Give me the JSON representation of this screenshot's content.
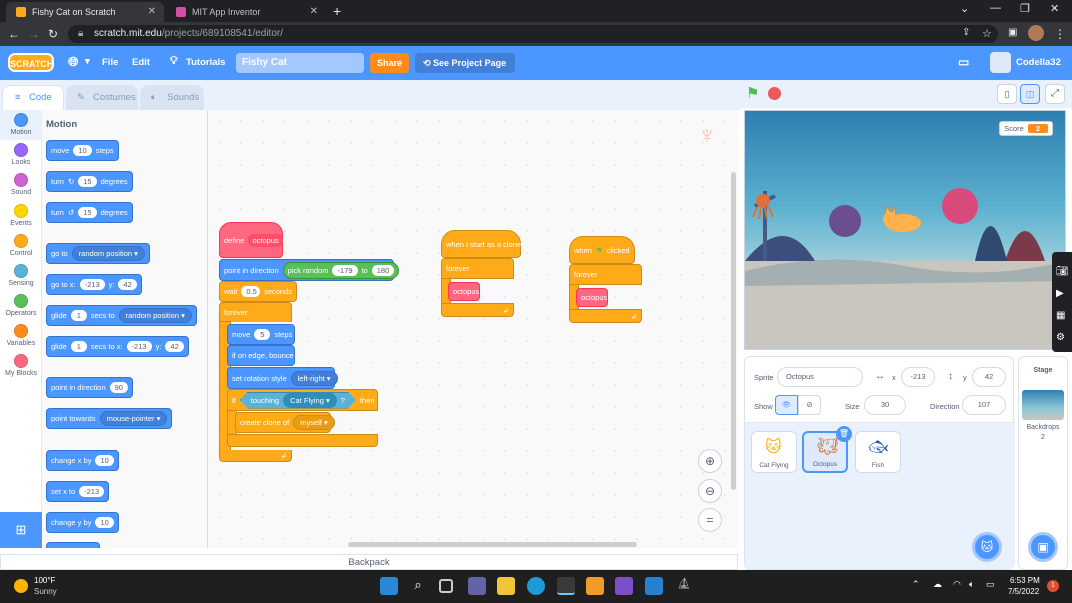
{
  "browser": {
    "tabs": [
      {
        "title": "Fishy Cat on Scratch",
        "active": true
      },
      {
        "title": "MIT App Inventor",
        "active": false
      }
    ],
    "url_host": "scratch.mit.edu",
    "url_path": "/projects/689108541/editor/"
  },
  "menubar": {
    "logo": "SCRATCH",
    "file": "File",
    "edit": "Edit",
    "tutorials": "Tutorials",
    "project_title": "Fishy Cat",
    "share": "Share",
    "see_project": "See Project Page",
    "username": "Codella32"
  },
  "editor_tabs": {
    "code": "Code",
    "costumes": "Costumes",
    "sounds": "Sounds"
  },
  "categories": [
    {
      "label": "Motion",
      "color": "#4c97ff"
    },
    {
      "label": "Looks",
      "color": "#9966ff"
    },
    {
      "label": "Sound",
      "color": "#cf63cf"
    },
    {
      "label": "Events",
      "color": "#ffd500"
    },
    {
      "label": "Control",
      "color": "#ffab19"
    },
    {
      "label": "Sensing",
      "color": "#5cb1d6"
    },
    {
      "label": "Operators",
      "color": "#59c059"
    },
    {
      "label": "Variables",
      "color": "#ff8c1a"
    },
    {
      "label": "My Blocks",
      "color": "#ff6680"
    }
  ],
  "palette": {
    "heading": "Motion",
    "move": {
      "a": "move",
      "v": "10",
      "b": "steps"
    },
    "turn_right": {
      "a": "turn",
      "v": "15",
      "b": "degrees"
    },
    "turn_left": {
      "a": "turn",
      "v": "15",
      "b": "degrees"
    },
    "goto": {
      "a": "go to",
      "dd": "random position"
    },
    "gotoxy": {
      "a": "go to x:",
      "x": "-213",
      "b": "y:",
      "y": "42"
    },
    "glide_to": {
      "a": "glide",
      "v": "1",
      "b": "secs to",
      "dd": "random position"
    },
    "glide_xy": {
      "a": "glide",
      "v": "1",
      "b": "secs to x:",
      "x": "-213",
      "c": "y:",
      "y": "42"
    },
    "point_dir": {
      "a": "point in direction",
      "v": "90"
    },
    "point_towards": {
      "a": "point towards",
      "dd": "mouse-pointer"
    },
    "change_x": {
      "a": "change x by",
      "v": "10"
    },
    "set_x": {
      "a": "set x to",
      "v": "-213"
    },
    "change_y": {
      "a": "change y by",
      "v": "10"
    }
  },
  "script_define": {
    "define": "define",
    "name": "octopus",
    "point_dir": "point in direction",
    "pick": "pick random",
    "min": "-179",
    "to": "to",
    "max": "180",
    "wait": "wait",
    "wait_v": "0.5",
    "seconds": "seconds",
    "forever": "forever",
    "move": "move",
    "move_v": "5",
    "steps": "steps",
    "bounce": "if on edge, bounce",
    "rotation": "set rotation style",
    "rotation_dd": "left-right",
    "if": "if",
    "touching": "touching",
    "touching_dd": "Cat Flying",
    "q": "?",
    "then": "then",
    "clone": "create clone of",
    "clone_dd": "myself"
  },
  "script_clone": {
    "hat": "when I start as a clone",
    "forever": "forever",
    "call": "octopus"
  },
  "script_flag": {
    "when": "when",
    "clicked": "clicked",
    "forever": "forever",
    "call": "octopus"
  },
  "backpack": "Backpack",
  "stage": {
    "score_label": "Score",
    "score_value": "2"
  },
  "sprite_info": {
    "sprite_label": "Sprite",
    "sprite_name": "Octopus",
    "x_label": "x",
    "x": "-213",
    "y_label": "y",
    "y": "42",
    "show_label": "Show",
    "size_label": "Size",
    "size": "30",
    "direction_label": "Direction",
    "direction": "107"
  },
  "sprites": [
    {
      "name": "Cat Flying",
      "selected": false
    },
    {
      "name": "Octopus",
      "selected": true
    },
    {
      "name": "Fish",
      "selected": false
    }
  ],
  "stage_pane": {
    "title": "Stage",
    "backdrops_label": "Backdrops",
    "backdrops_count": "2"
  },
  "taskbar": {
    "temp": "100°F",
    "weather": "Sunny",
    "time": "6:53 PM",
    "date": "7/5/2022",
    "notif": "1"
  }
}
